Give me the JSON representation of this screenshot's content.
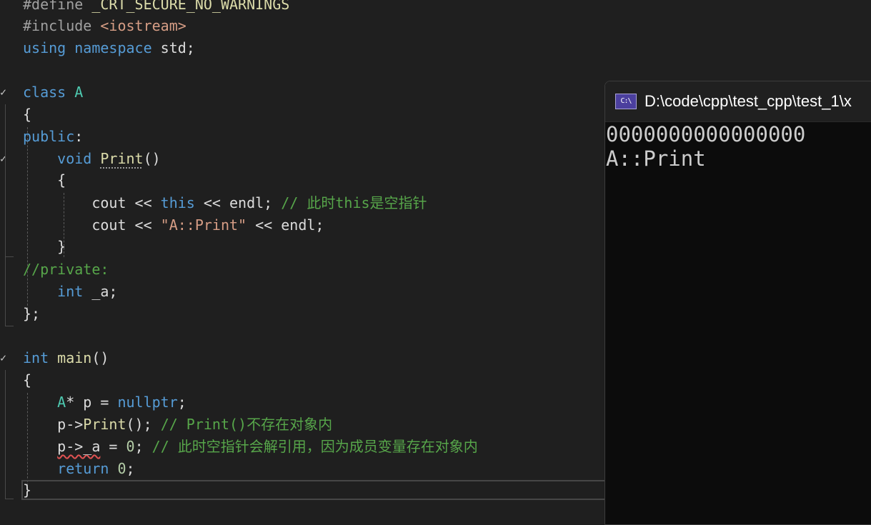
{
  "editor": {
    "lines": {
      "l1": {
        "pp": "#define",
        "macro": "_CRT_SECURE_NO_WARNINGS"
      },
      "l2": {
        "pp": "#include",
        "header": "<iostream>"
      },
      "l3": {
        "kw1": "using",
        "kw2": "namespace",
        "rest": " std;"
      },
      "l5": {
        "kw": "class",
        "name": "A"
      },
      "l6": {
        "text": "{"
      },
      "l7": {
        "kw": "public",
        "rest": ":"
      },
      "l8": {
        "kw": "void",
        "fn": "Print",
        "rest": "()"
      },
      "l9": {
        "text": "{"
      },
      "l10": {
        "a": "cout << ",
        "kw": "this",
        "b": " << endl; ",
        "comment": "// 此时this是空指针"
      },
      "l11": {
        "a": "cout << ",
        "str": "\"A::Print\"",
        "b": " << endl;"
      },
      "l12": {
        "text": "}"
      },
      "l13": {
        "comment": "//private:"
      },
      "l14": {
        "kw": "int",
        "rest": " _a;"
      },
      "l15": {
        "text": "};"
      },
      "l17": {
        "kw": "int",
        "fn": "main",
        "rest": "()"
      },
      "l18": {
        "text": "{"
      },
      "l19": {
        "ty": "A",
        "a": "* p = ",
        "kw": "nullptr",
        "b": ";"
      },
      "l20": {
        "a": "p->",
        "fn": "Print",
        "b": "(); ",
        "comment": "// Print()不存在对象内"
      },
      "l21": {
        "err": "p->_a",
        "a": " = ",
        "num": "0",
        "b": "; ",
        "comment": "// 此时空指针会解引用，因为成员变量存在对象内"
      },
      "l22": {
        "kw": "return",
        "a": " ",
        "num": "0",
        "b": ";"
      },
      "l23": {
        "text": "}"
      }
    },
    "fold_glyph": "✓"
  },
  "console": {
    "title": "D:\\code\\cpp\\test_cpp\\test_1\\x",
    "icon_text": "C:\\",
    "output": [
      "0000000000000000",
      "A::Print"
    ]
  },
  "colors": {
    "background": "#1f1f1f",
    "keyword": "#569cd6",
    "type": "#4ec9b0",
    "function": "#dcdcaa",
    "string": "#d69d85",
    "comment": "#57a64a",
    "console_bg": "#0c0c0c"
  }
}
